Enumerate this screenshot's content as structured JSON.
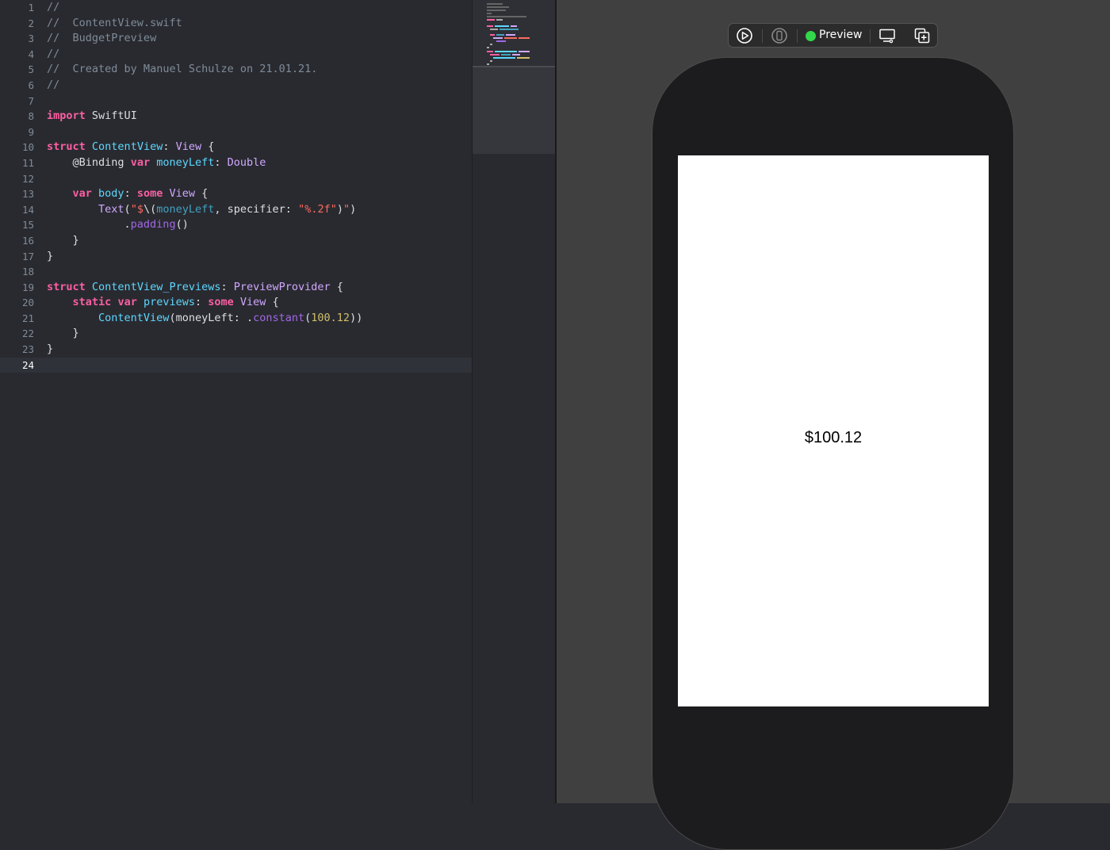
{
  "editor": {
    "file_name": "ContentView.swift",
    "project_name": "BudgetPreview",
    "author_line": "Created by Manuel Schulze on 21.01.21.",
    "current_line": 24,
    "lines": [
      {
        "n": "1"
      },
      {
        "n": "2"
      },
      {
        "n": "3"
      },
      {
        "n": "4"
      },
      {
        "n": "5"
      },
      {
        "n": "6"
      },
      {
        "n": "7"
      },
      {
        "n": "8"
      },
      {
        "n": "9"
      },
      {
        "n": "10"
      },
      {
        "n": "11"
      },
      {
        "n": "12"
      },
      {
        "n": "13"
      },
      {
        "n": "14"
      },
      {
        "n": "15"
      },
      {
        "n": "16"
      },
      {
        "n": "17"
      },
      {
        "n": "18"
      },
      {
        "n": "19"
      },
      {
        "n": "20"
      },
      {
        "n": "21"
      },
      {
        "n": "22"
      },
      {
        "n": "23"
      },
      {
        "n": "24"
      }
    ]
  },
  "code_tokens": {
    "comment": "//",
    "import_kw": "import",
    "swiftui": "SwiftUI",
    "struct_kw": "struct",
    "content_view": "ContentView",
    "view": "View",
    "binding": "@Binding",
    "var_kw": "var",
    "money_left": "moneyLeft",
    "double": "Double",
    "body": "body",
    "some_kw": "some",
    "text_fn": "Text",
    "string_open": "\"$",
    "interp": "\\(",
    "specifier": "specifier:",
    "format_str": "\"%.2f\"",
    "string_close": "\"",
    "padding": "padding",
    "previews_struct": "ContentView_Previews",
    "preview_provider": "PreviewProvider",
    "static_kw": "static",
    "previews": "previews",
    "money_left_label": "moneyLeft:",
    "constant": "constant",
    "value": "100.12"
  },
  "canvas": {
    "toolbar": {
      "preview_label": "Preview",
      "status_color": "#32d74b"
    },
    "preview_text": "$100.12"
  },
  "colors": {
    "editor_bg": "#292a30",
    "keyword": "#fc5fa3",
    "comment": "#7f8c98",
    "type_decl": "#5dd8ff",
    "type_ref": "#d0a8ff",
    "string": "#fc6a5d",
    "number": "#d0bf69",
    "canvas_bg": "#404040"
  }
}
